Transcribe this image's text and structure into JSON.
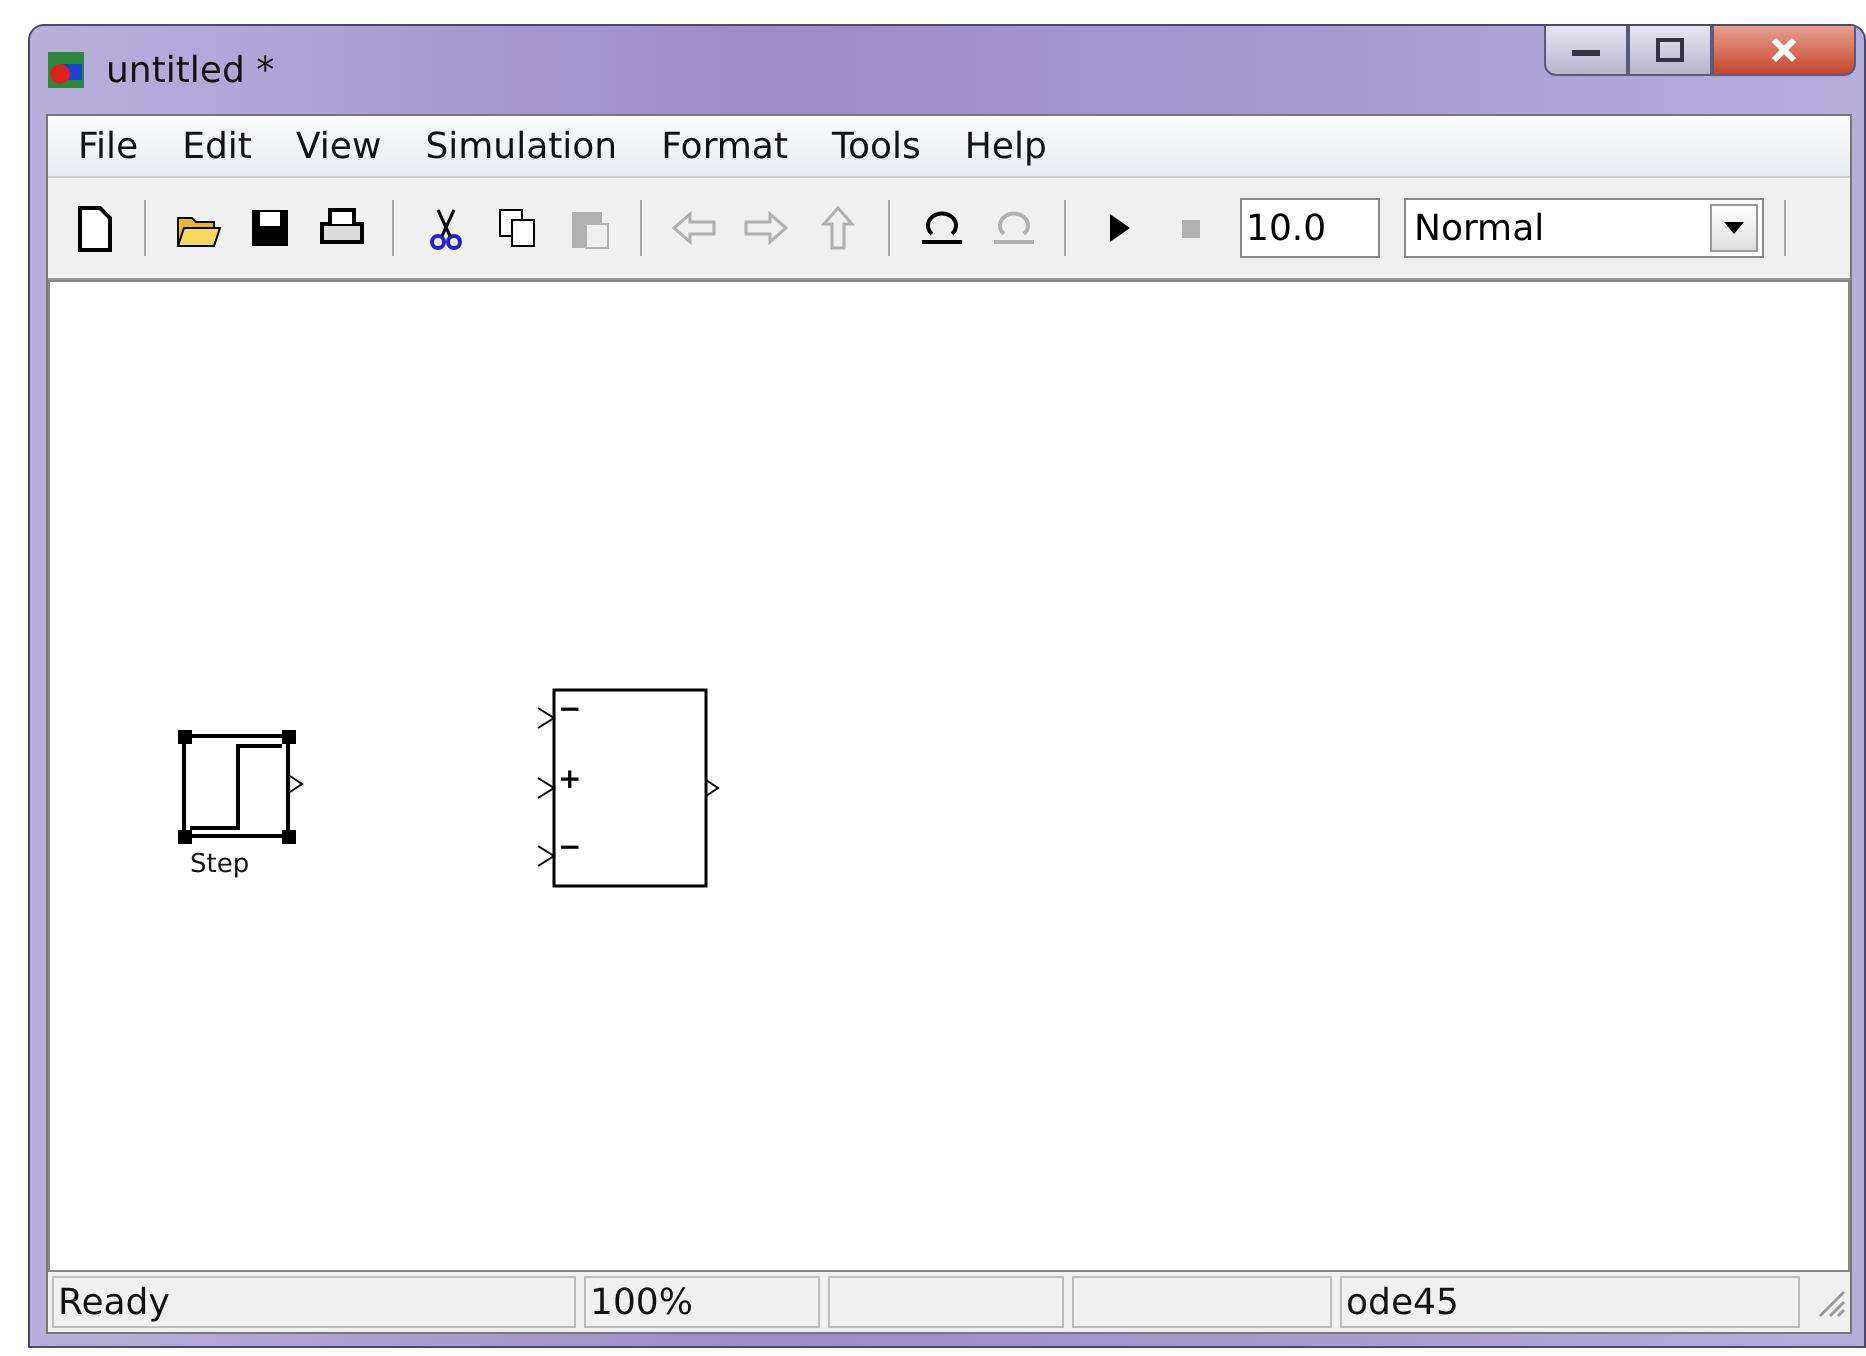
{
  "window": {
    "title": "untitled *"
  },
  "menu": [
    "File",
    "Edit",
    "View",
    "Simulation",
    "Format",
    "Tools",
    "Help"
  ],
  "toolbar": [
    {
      "kind": "new",
      "disabled": false
    },
    {
      "kind": "sep"
    },
    {
      "kind": "open",
      "disabled": false
    },
    {
      "kind": "save",
      "disabled": false
    },
    {
      "kind": "print",
      "disabled": false
    },
    {
      "kind": "sep"
    },
    {
      "kind": "cut",
      "disabled": false
    },
    {
      "kind": "copy",
      "disabled": false
    },
    {
      "kind": "paste",
      "disabled": true
    },
    {
      "kind": "sep"
    },
    {
      "kind": "back",
      "disabled": true
    },
    {
      "kind": "forward",
      "disabled": true
    },
    {
      "kind": "up",
      "disabled": true
    },
    {
      "kind": "sep"
    },
    {
      "kind": "undo",
      "disabled": false
    },
    {
      "kind": "redo",
      "disabled": true
    },
    {
      "kind": "sep"
    },
    {
      "kind": "play",
      "disabled": false
    },
    {
      "kind": "stop",
      "disabled": true
    }
  ],
  "stop_time": "10.0",
  "mode": "Normal",
  "blocks": [
    {
      "kind": "step",
      "label": "Step",
      "selected": true
    },
    {
      "kind": "sum",
      "selected": false,
      "signs": [
        "−",
        "+",
        "−"
      ]
    }
  ],
  "status_bar": {
    "message": "Ready",
    "zoom": "100%",
    "solver": "ode45"
  }
}
